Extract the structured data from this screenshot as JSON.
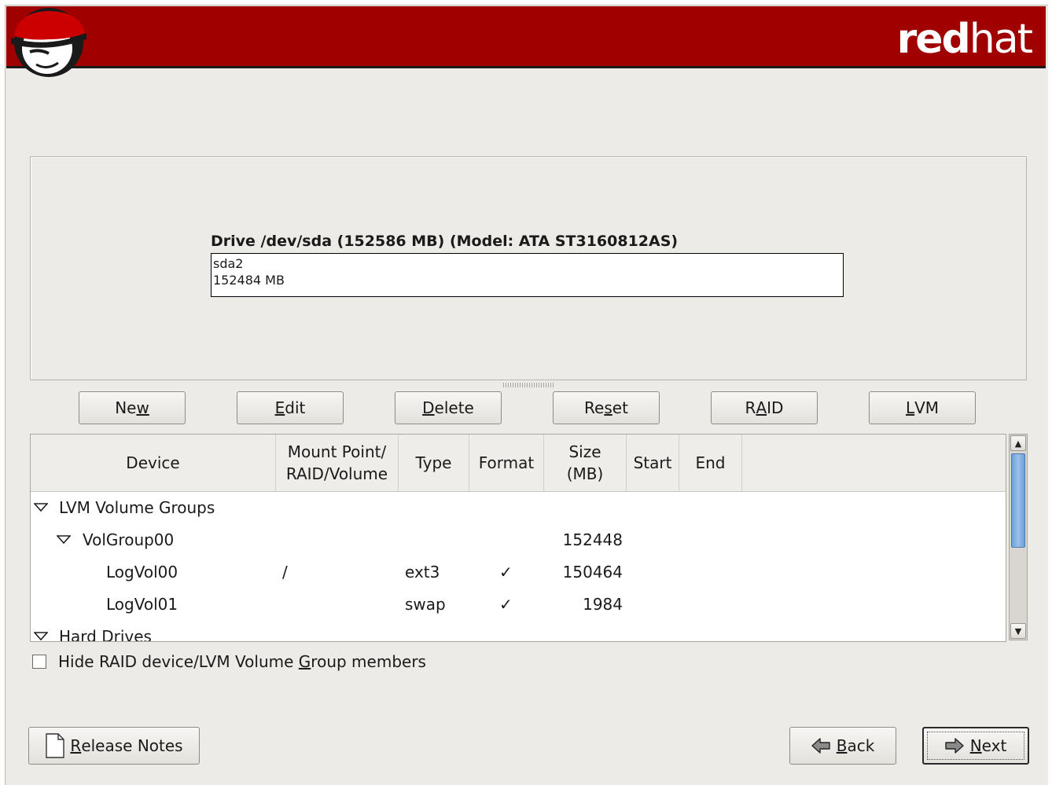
{
  "brand": {
    "wordmark_bold": "red",
    "wordmark_light": "hat",
    "colors": {
      "banner": "#a00000",
      "window": "#edebe8",
      "scroll_thumb": "#7eaade"
    }
  },
  "drive": {
    "title": "Drive /dev/sda (152586 MB) (Model: ATA ST3160812AS)",
    "partition_name": "sda2",
    "partition_size": "152484 MB"
  },
  "toolbar": {
    "new": {
      "pre": "Ne",
      "mn": "w",
      "post": ""
    },
    "edit": {
      "pre": "",
      "mn": "E",
      "post": "dit"
    },
    "delete": {
      "pre": "",
      "mn": "D",
      "post": "elete"
    },
    "reset": {
      "pre": "Re",
      "mn": "s",
      "post": "et"
    },
    "raid": {
      "pre": "R",
      "mn": "A",
      "post": "ID"
    },
    "lvm": {
      "pre": "",
      "mn": "L",
      "post": "VM"
    }
  },
  "table": {
    "columns": {
      "device": "Device",
      "mount_1": "Mount Point/",
      "mount_2": "RAID/Volume",
      "type": "Type",
      "format": "Format",
      "size_1": "Size",
      "size_2": "(MB)",
      "start": "Start",
      "end": "End"
    },
    "rows": [
      {
        "device": "LVM Volume Groups",
        "mount": "",
        "type": "",
        "format": "",
        "size": ""
      },
      {
        "device": "VolGroup00",
        "mount": "",
        "type": "",
        "format": "",
        "size": "152448"
      },
      {
        "device": "LogVol00",
        "mount": "/",
        "type": "ext3",
        "format": "✓",
        "size": "150464"
      },
      {
        "device": "LogVol01",
        "mount": "",
        "type": "swap",
        "format": "✓",
        "size": "1984"
      },
      {
        "device": "Hard Drives",
        "mount": "",
        "type": "",
        "format": "",
        "size": ""
      }
    ]
  },
  "hide_members": {
    "pre": "Hide RAID device/LVM Volume ",
    "mn": "G",
    "post": "roup members",
    "checked": false
  },
  "footer": {
    "release_notes": {
      "pre": "",
      "mn": "R",
      "post": "elease Notes"
    },
    "back": {
      "pre": "",
      "mn": "B",
      "post": "ack"
    },
    "next": {
      "pre": "",
      "mn": "N",
      "post": "ext"
    }
  }
}
